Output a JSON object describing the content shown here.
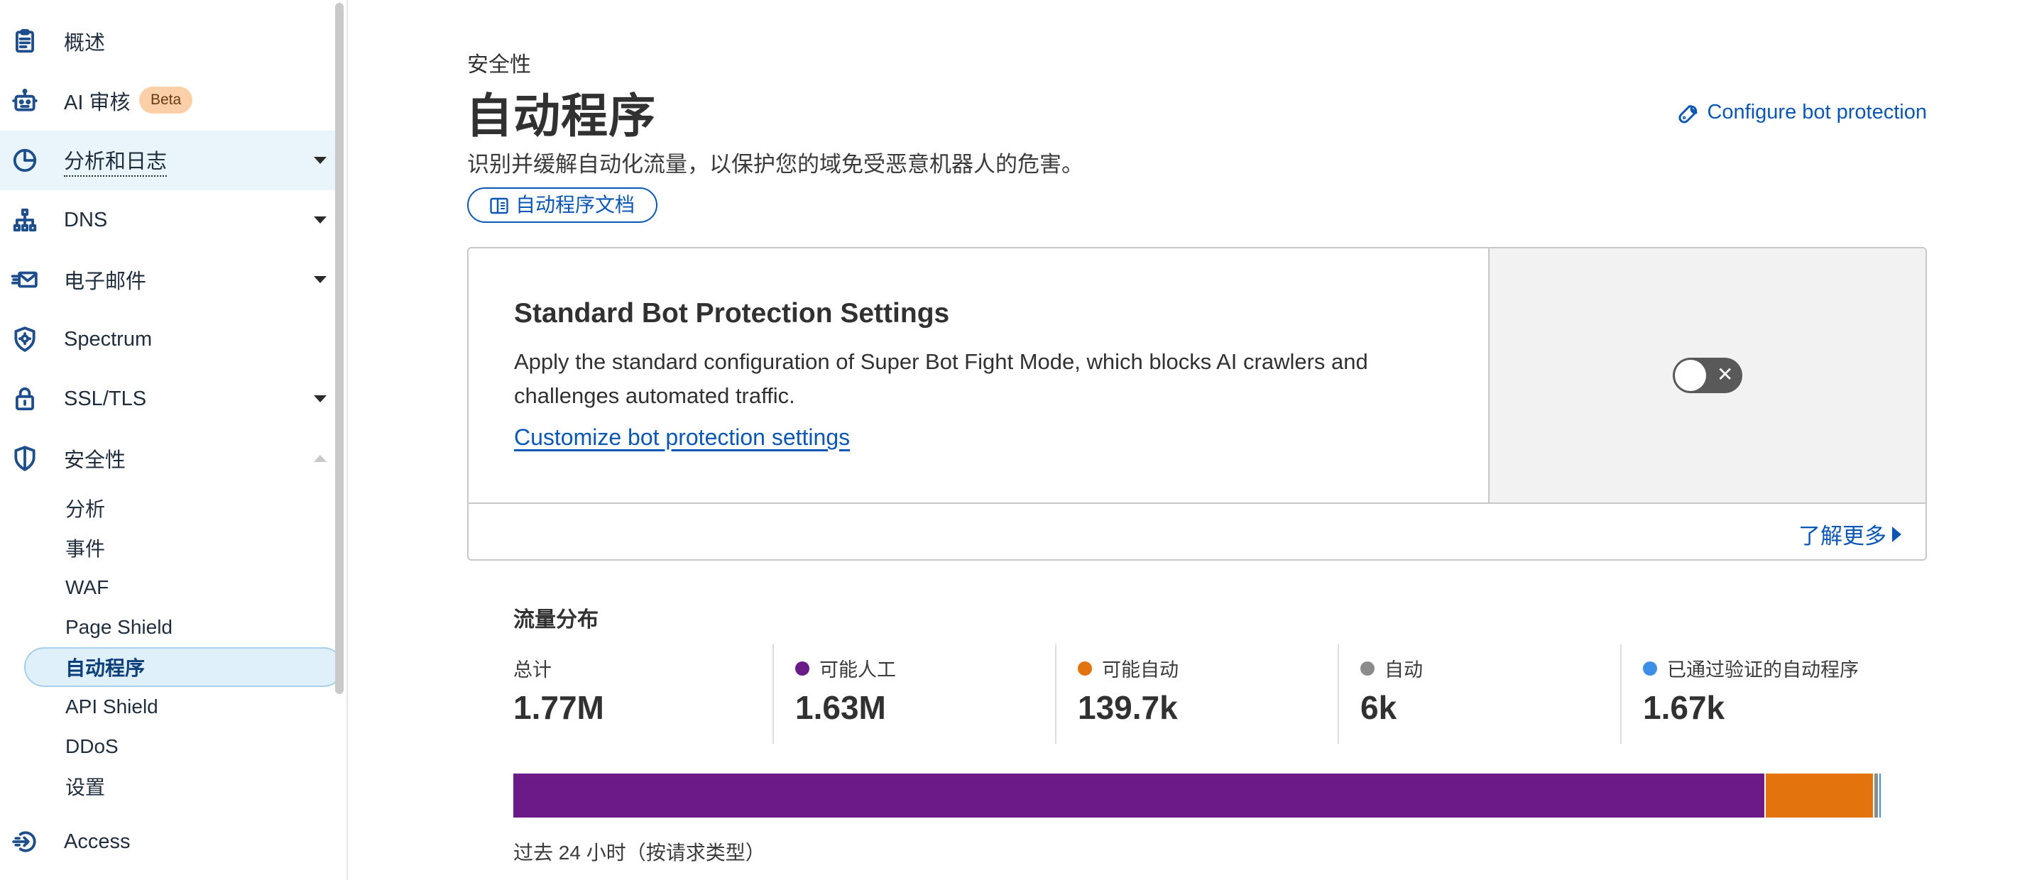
{
  "sidebar": {
    "items": [
      {
        "label": "概述",
        "icon": "clipboard-icon"
      },
      {
        "label": "AI 审核",
        "icon": "bot-icon",
        "badge": "Beta"
      },
      {
        "label": "分析和日志",
        "icon": "pie-chart-icon"
      },
      {
        "label": "DNS",
        "icon": "network-icon"
      },
      {
        "label": "电子邮件",
        "icon": "mail-icon"
      },
      {
        "label": "Spectrum",
        "icon": "shield-gear-icon"
      },
      {
        "label": "SSL/TLS",
        "icon": "lock-icon"
      },
      {
        "label": "安全性",
        "icon": "shield-icon"
      },
      {
        "label": "Access",
        "icon": "access-icon"
      }
    ],
    "security_subitems": [
      "分析",
      "事件",
      "WAF",
      "Page Shield",
      "自动程序",
      "API Shield",
      "DDoS",
      "设置"
    ],
    "active_subitem": "自动程序"
  },
  "header": {
    "breadcrumb": "安全性",
    "title": "自动程序",
    "subtitle": "识别并缓解自动化流量，以保护您的域免受恶意机器人的危害。",
    "docs_button": "自动程序文档",
    "configure_link": "Configure bot protection"
  },
  "card": {
    "title": "Standard Bot Protection Settings",
    "description": "Apply the standard configuration of Super Bot Fight Mode, which blocks AI crawlers and challenges automated traffic.",
    "link": "Customize bot protection settings",
    "toggle_on": false,
    "learn_more": "了解更多"
  },
  "traffic": {
    "title": "流量分布",
    "caption": "过去 24 小时（按请求类型）",
    "stats": [
      {
        "label": "总计",
        "value": "1.77M",
        "color": null
      },
      {
        "label": "可能人工",
        "value": "1.63M",
        "color": "#6a1b87"
      },
      {
        "label": "可能自动",
        "value": "139.7k",
        "color": "#e2730d"
      },
      {
        "label": "自动",
        "value": "6k",
        "color": "#8c8c8c"
      },
      {
        "label": "已通过验证的自动程序",
        "value": "1.67k",
        "color": "#3b8fe6"
      }
    ],
    "bar": [
      {
        "name": "可能人工",
        "share": 0.9175,
        "color": "#6a1b87"
      },
      {
        "name": "可能自动",
        "share": 0.0786,
        "color": "#e2730d"
      },
      {
        "name": "自动",
        "share": 0.003,
        "color": "#8c8c8c"
      },
      {
        "name": "已通过验证的自动程序",
        "share": 0.0009,
        "color": "#3b8fe6"
      }
    ]
  }
}
